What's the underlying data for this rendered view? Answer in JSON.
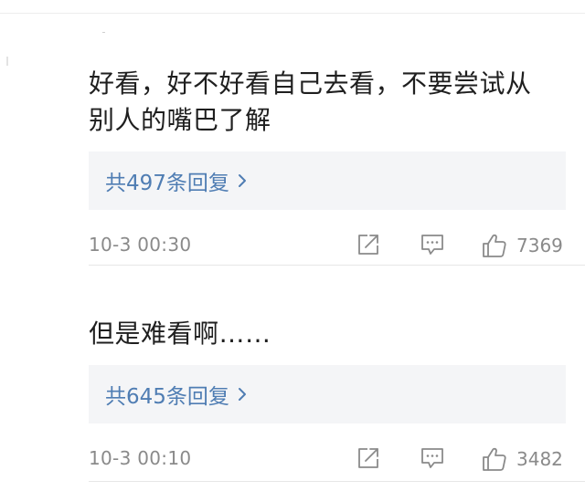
{
  "comments": [
    {
      "text": "好看，好不好看自己去看，不要尝试从别人的嘴巴了解",
      "replies_label": "共497条回复",
      "timestamp": "10-3 00:30",
      "likes": "7369"
    },
    {
      "text": "但是难看啊……",
      "replies_label": "共645条回复",
      "timestamp": "10-3 00:10",
      "likes": "3482"
    }
  ],
  "icons": {
    "share": "share-icon",
    "reply": "reply-comment-icon",
    "like": "thumbs-up-icon",
    "chevron": "chevron-right-icon"
  },
  "colors": {
    "link": "#4f7db3",
    "meta": "#8a8a8a",
    "replies_bg": "#f4f5f7",
    "text": "#1f1f1f"
  }
}
